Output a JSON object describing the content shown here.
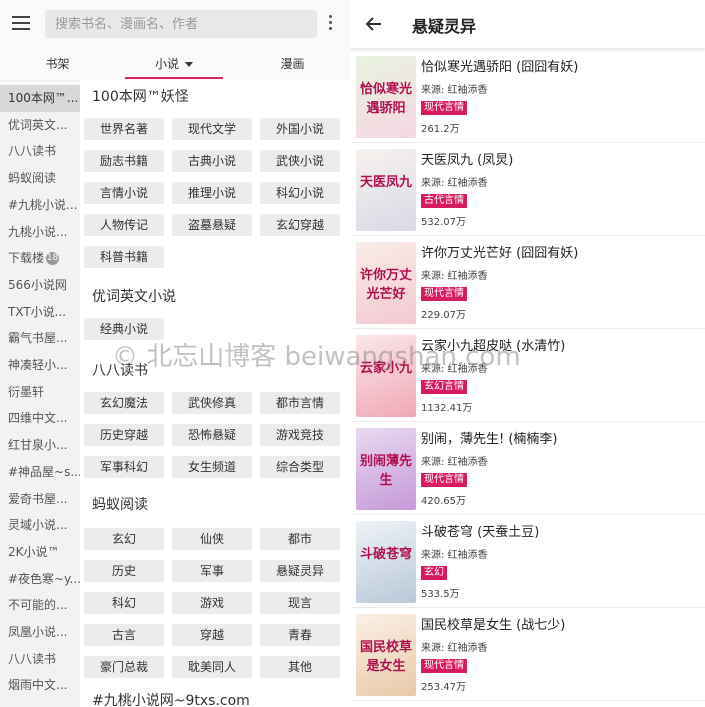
{
  "search": {
    "placeholder": "搜索书名、漫画名、作者"
  },
  "tabs": [
    {
      "label": "书架"
    },
    {
      "label": "小说"
    },
    {
      "label": "漫画"
    }
  ],
  "sources": [
    {
      "label": "100本网™..."
    },
    {
      "label": "优词英文..."
    },
    {
      "label": "八八读书"
    },
    {
      "label": "蚂蚁阅读"
    },
    {
      "label": "#九桃小说..."
    },
    {
      "label": "九桃小说..."
    },
    {
      "label": "下载楼",
      "badge": "18"
    },
    {
      "label": "566小说网"
    },
    {
      "label": "TXT小说..."
    },
    {
      "label": "霸气书屋..."
    },
    {
      "label": "神凑轻小..."
    },
    {
      "label": "衍墨轩"
    },
    {
      "label": "四维中文..."
    },
    {
      "label": "红甘泉小..."
    },
    {
      "label": "#神品屋~s..."
    },
    {
      "label": "爱奇书屋..."
    },
    {
      "label": "灵域小说..."
    },
    {
      "label": "2K小说™"
    },
    {
      "label": "#夜色寒~y..."
    },
    {
      "label": "不可能的..."
    },
    {
      "label": "凤凰小说..."
    },
    {
      "label": "八八读书"
    },
    {
      "label": "烟雨中文..."
    }
  ],
  "categories": [
    {
      "title": "100本网™妖怪",
      "items": [
        "世界名著",
        "现代文学",
        "外国小说",
        "励志书籍",
        "古典小说",
        "武侠小说",
        "言情小说",
        "推理小说",
        "科幻小说",
        "人物传记",
        "盗墓悬疑",
        "玄幻穿越",
        "科普书籍"
      ]
    },
    {
      "title": "优词英文小说",
      "items": [
        "经典小说"
      ]
    },
    {
      "title": "八八读书",
      "items": [
        "玄幻魔法",
        "武侠修真",
        "都市言情",
        "历史穿越",
        "恐怖悬疑",
        "游戏竞技",
        "军事科幻",
        "女生频道",
        "综合类型"
      ]
    },
    {
      "title": "蚂蚁阅读",
      "items": [
        "玄幻",
        "仙侠",
        "都市",
        "历史",
        "军事",
        "悬疑灵异",
        "科幻",
        "游戏",
        "现言",
        "古言",
        "穿越",
        "青春",
        "豪门总裁",
        "耽美同人",
        "其他"
      ]
    },
    {
      "title": "#九桃小说网~9txs.com",
      "items": []
    }
  ],
  "right": {
    "title": "悬疑灵异",
    "books": [
      {
        "title": "恰似寒光遇骄阳 (囧囧有妖)",
        "source": "来源: 红袖添香",
        "tag": "现代言情",
        "count": "261.2万",
        "cover_text": "恰似寒光遇骄阳",
        "cover_colors": [
          "#e8f3e0",
          "#f5d7e2"
        ]
      },
      {
        "title": "天医凤九 (凤炅)",
        "source": "来源: 红袖添香",
        "tag": "古代言情",
        "count": "532.07万",
        "cover_text": "天医凤九",
        "cover_colors": [
          "#f7f2ee",
          "#d9d9e6"
        ]
      },
      {
        "title": "许你万丈光芒好 (囧囧有妖)",
        "source": "来源: 红袖添香",
        "tag": "现代言情",
        "count": "229.07万",
        "cover_text": "许你万丈光芒好",
        "cover_colors": [
          "#f9ede6",
          "#f3c9d2"
        ]
      },
      {
        "title": "云家小九超皮哒 (水清竹)",
        "source": "来源: 红袖添香",
        "tag": "玄幻言情",
        "count": "1132.41万",
        "cover_text": "云家小九",
        "cover_colors": [
          "#fbe8e8",
          "#f0a8b8"
        ]
      },
      {
        "title": "别闹，薄先生! (楠楠李)",
        "source": "来源: 红袖添香",
        "tag": "现代言情",
        "count": "420.65万",
        "cover_text": "别闹薄先生",
        "cover_colors": [
          "#e9d9f1",
          "#c59ad8"
        ]
      },
      {
        "title": "斗破苍穹 (天蚕土豆)",
        "source": "来源: 红袖添香",
        "tag": "玄幻",
        "count": "533.5万",
        "cover_text": "斗破苍穹",
        "cover_colors": [
          "#eef3f7",
          "#b9c8d8"
        ]
      },
      {
        "title": "国民校草是女生 (战七少)",
        "source": "来源: 红袖添香",
        "tag": "现代言情",
        "count": "253.47万",
        "cover_text": "国民校草是女生",
        "cover_colors": [
          "#fbf0e6",
          "#e8c9a8"
        ]
      }
    ]
  },
  "watermark": "© 北忘山博客 beiwangshan.com",
  "colors": {
    "accent": "#e0245e",
    "tag": "#d81b60"
  }
}
